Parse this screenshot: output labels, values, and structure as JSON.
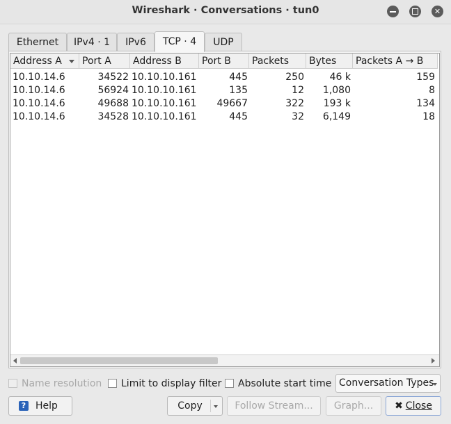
{
  "window": {
    "title": "Wireshark · Conversations · tun0"
  },
  "tabs": [
    {
      "label": "Ethernet"
    },
    {
      "label": "IPv4 · 1"
    },
    {
      "label": "IPv6"
    },
    {
      "label": "TCP · 4"
    },
    {
      "label": "UDP"
    }
  ],
  "table": {
    "columns": [
      "Address A",
      "Port A",
      "Address B",
      "Port B",
      "Packets",
      "Bytes",
      "Packets A → B"
    ],
    "rows": [
      [
        "10.10.14.6",
        "34522",
        "10.10.10.161",
        "445",
        "250",
        "46 k",
        "159"
      ],
      [
        "10.10.14.6",
        "56924",
        "10.10.10.161",
        "135",
        "12",
        "1,080",
        "8"
      ],
      [
        "10.10.14.6",
        "49688",
        "10.10.10.161",
        "49667",
        "322",
        "193 k",
        "134"
      ],
      [
        "10.10.14.6",
        "34528",
        "10.10.10.161",
        "445",
        "32",
        "6,149",
        "18"
      ]
    ]
  },
  "options": {
    "name_resolution": "Name resolution",
    "limit_filter": "Limit to display filter",
    "absolute_time": "Absolute start time",
    "conversation_types": "Conversation Types"
  },
  "buttons": {
    "help": "Help",
    "copy": "Copy",
    "follow_stream": "Follow Stream...",
    "graph": "Graph...",
    "close": "Close",
    "help_icon_glyph": "?",
    "close_icon_glyph": "✖"
  },
  "icons": {
    "minimize": "minimize-icon",
    "maximize": "maximize-icon",
    "close": "close-icon"
  }
}
